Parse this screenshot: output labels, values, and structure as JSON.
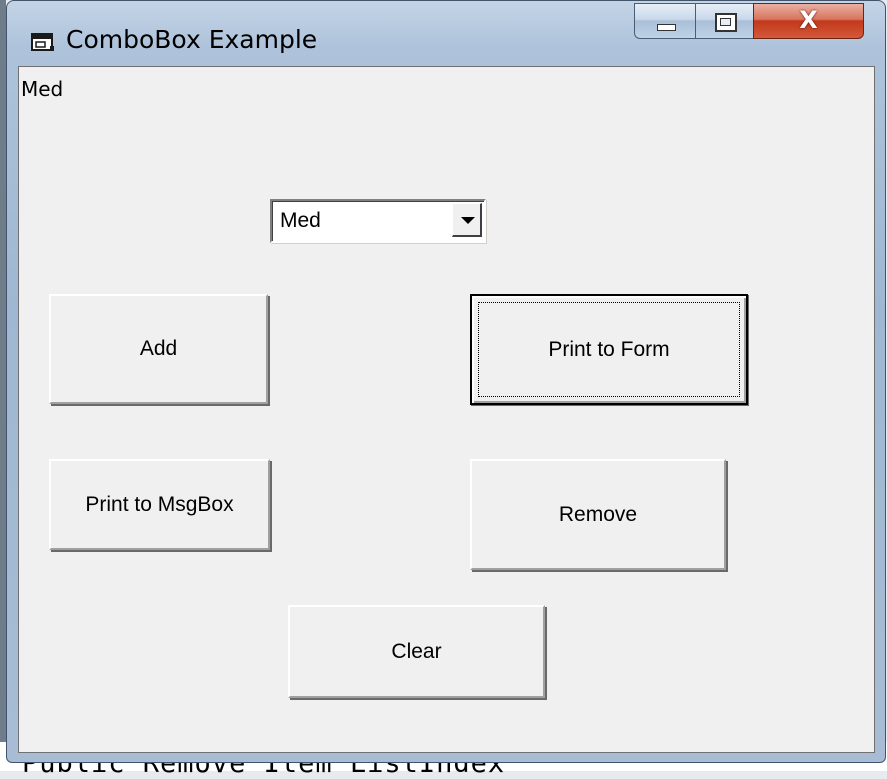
{
  "background": {
    "code_line": "Public Remove Item ListIndex"
  },
  "window": {
    "title": "ComboBox Example",
    "caption_buttons": {
      "minimize_icon": "minimize-icon",
      "maximize_icon": "maximize-icon",
      "close_label": "X"
    }
  },
  "form": {
    "printed_text": "Med",
    "combo": {
      "value": "Med"
    },
    "buttons": {
      "add": "Add",
      "print_to_form": "Print to Form",
      "print_to_msgbox": "Print to MsgBox",
      "remove": "Remove",
      "clear": "Clear"
    }
  },
  "colors": {
    "client_bg": "#f0f0f0",
    "frame": "#a8bdd5",
    "close_button": "#c2381a"
  }
}
